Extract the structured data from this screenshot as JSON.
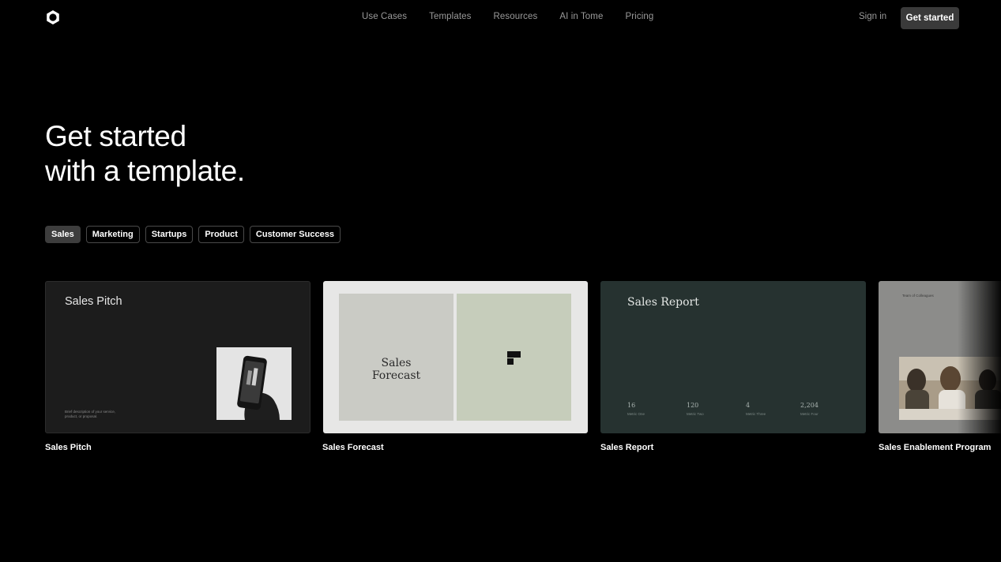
{
  "nav": {
    "links": [
      "Use Cases",
      "Templates",
      "Resources",
      "AI in Tome",
      "Pricing"
    ],
    "sign_in": "Sign in",
    "get_started": "Get started"
  },
  "hero": {
    "line1": "Get started",
    "line2": "with a template."
  },
  "filters": [
    "Sales",
    "Marketing",
    "Startups",
    "Product",
    "Customer Success"
  ],
  "active_filter": "Sales",
  "templates": [
    {
      "name": "Sales Pitch",
      "preview_title": "Sales Pitch",
      "preview_note": "Brief description of your service, product, or proposal."
    },
    {
      "name": "Sales Forecast",
      "preview_title_line1": "Sales",
      "preview_title_line2": "Forecast"
    },
    {
      "name": "Sales Report",
      "preview_title": "Sales Report",
      "stats": [
        {
          "value": "16",
          "label": "Metric One"
        },
        {
          "value": "120",
          "label": "Metric Two"
        },
        {
          "value": "4",
          "label": "Metric Three"
        },
        {
          "value": "2,204",
          "label": "Metric Four"
        }
      ]
    },
    {
      "name": "Sales Enablement Program",
      "preview_note": "Team of Colleagues"
    }
  ],
  "colors": {
    "background": "#000000",
    "chip_active": "#3d3d3d",
    "cta_bg": "#3a3a3a",
    "report_card": "#263230",
    "forecast_left": "#cacbc5",
    "forecast_right": "#c6cdbb"
  }
}
